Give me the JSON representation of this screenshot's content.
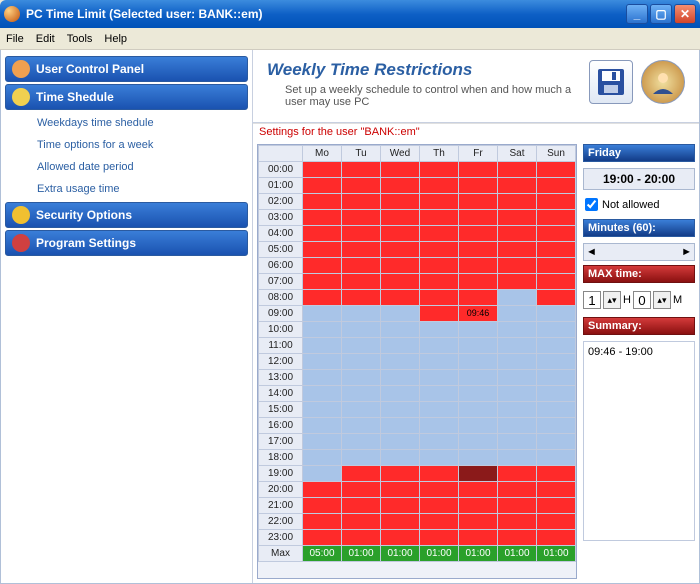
{
  "window": {
    "title": "PC Time Limit (Selected user: BANK::em)",
    "menu": [
      "File",
      "Edit",
      "Tools",
      "Help"
    ]
  },
  "header": {
    "title": "Weekly Time Restrictions",
    "subtitle": "Set up a weekly schedule to control when and how much a user may use  PC"
  },
  "sidebar": {
    "sections": [
      {
        "label": "User Control Panel",
        "icon": "user-icon",
        "items": []
      },
      {
        "label": "Time Shedule",
        "icon": "clock-icon",
        "items": [
          "Weekdays time shedule",
          "Time options for a week",
          "Allowed date period",
          "Extra usage time"
        ]
      },
      {
        "label": "Security Options",
        "icon": "lock-icon",
        "items": []
      },
      {
        "label": "Program Settings",
        "icon": "gear-icon",
        "items": []
      }
    ]
  },
  "settings_for": "Settings for the user \"BANK::em\"",
  "schedule": {
    "days": [
      "Mo",
      "Tu",
      "Wed",
      "Th",
      "Fr",
      "Sat",
      "Sun"
    ],
    "hours": [
      "00:00",
      "01:00",
      "02:00",
      "03:00",
      "04:00",
      "05:00",
      "06:00",
      "07:00",
      "08:00",
      "09:00",
      "10:00",
      "11:00",
      "12:00",
      "13:00",
      "14:00",
      "15:00",
      "16:00",
      "17:00",
      "18:00",
      "19:00",
      "20:00",
      "21:00",
      "22:00",
      "23:00"
    ],
    "cells": [
      [
        "r",
        "r",
        "r",
        "r",
        "r",
        "r",
        "r"
      ],
      [
        "r",
        "r",
        "r",
        "r",
        "r",
        "r",
        "r"
      ],
      [
        "r",
        "r",
        "r",
        "r",
        "r",
        "r",
        "r"
      ],
      [
        "r",
        "r",
        "r",
        "r",
        "r",
        "r",
        "r"
      ],
      [
        "r",
        "r",
        "r",
        "r",
        "r",
        "r",
        "r"
      ],
      [
        "r",
        "r",
        "r",
        "r",
        "r",
        "r",
        "r"
      ],
      [
        "r",
        "r",
        "r",
        "r",
        "r",
        "r",
        "r"
      ],
      [
        "r",
        "r",
        "r",
        "r",
        "r",
        "r",
        "r"
      ],
      [
        "r",
        "r",
        "r",
        "r",
        "r",
        "b",
        "r"
      ],
      [
        "b",
        "b",
        "b",
        "r",
        "r",
        "b",
        "b"
      ],
      [
        "b",
        "b",
        "b",
        "b",
        "b",
        "b",
        "b"
      ],
      [
        "b",
        "b",
        "b",
        "b",
        "b",
        "b",
        "b"
      ],
      [
        "b",
        "b",
        "b",
        "b",
        "b",
        "b",
        "b"
      ],
      [
        "b",
        "b",
        "b",
        "b",
        "b",
        "b",
        "b"
      ],
      [
        "b",
        "b",
        "b",
        "b",
        "b",
        "b",
        "b"
      ],
      [
        "b",
        "b",
        "b",
        "b",
        "b",
        "b",
        "b"
      ],
      [
        "b",
        "b",
        "b",
        "b",
        "b",
        "b",
        "b"
      ],
      [
        "b",
        "b",
        "b",
        "b",
        "b",
        "b",
        "b"
      ],
      [
        "b",
        "b",
        "b",
        "b",
        "b",
        "b",
        "b"
      ],
      [
        "b",
        "r",
        "r",
        "r",
        "d",
        "r",
        "r"
      ],
      [
        "r",
        "r",
        "r",
        "r",
        "r",
        "r",
        "r"
      ],
      [
        "r",
        "r",
        "r",
        "r",
        "r",
        "r",
        "r"
      ],
      [
        "r",
        "r",
        "r",
        "r",
        "r",
        "r",
        "r"
      ],
      [
        "r",
        "r",
        "r",
        "r",
        "r",
        "r",
        "r"
      ]
    ],
    "clock_label": "09:46",
    "clock_row": 9,
    "clock_col": 4,
    "max_label": "Max",
    "max_row": [
      "05:00",
      "01:00",
      "01:00",
      "01:00",
      "01:00",
      "01:00",
      "01:00"
    ]
  },
  "rightpanel": {
    "day_label": "Friday",
    "time_range": "19:00 - 20:00",
    "not_allowed": "Not allowed",
    "not_allowed_checked": true,
    "minutes_label": "Minutes (60):",
    "max_time_label": "MAX time:",
    "max_h": "1",
    "max_m": "0",
    "h_label": "H",
    "m_label": "M",
    "summary_label": "Summary:",
    "summary_items": [
      "09:46 - 19:00"
    ]
  }
}
